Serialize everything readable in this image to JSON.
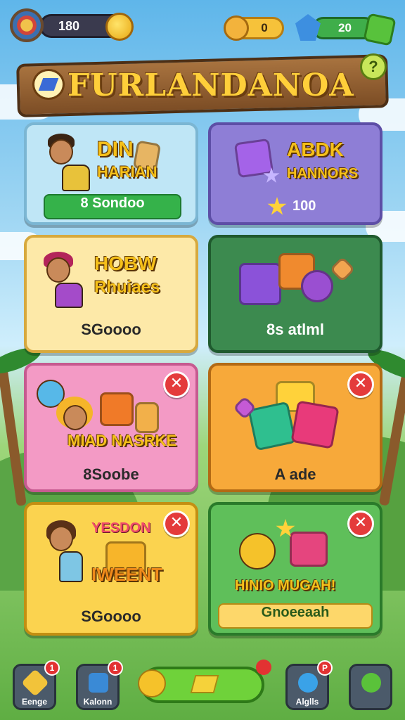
{
  "hud": {
    "coins": "180",
    "gold": "0",
    "gems": "20"
  },
  "banner": {
    "title": "FURLANDANOA"
  },
  "cards": [
    {
      "title_line1": "DIN",
      "title_line2": "HARIAN",
      "sub": "8 Sondoo",
      "color": "#bfe6f6"
    },
    {
      "title_line1": "ABDK",
      "title_line2": "HANNORS",
      "sub": "100",
      "color": "#8e7ed6"
    },
    {
      "title_line1": "HOBW",
      "title_line2": "Rhuiaes",
      "sub": "SGoooo",
      "color": "#fde9a8"
    },
    {
      "title_line1": "",
      "title_line2": "",
      "sub": "8s atlml",
      "color": "#3c8a4f"
    },
    {
      "title_line1": "MIAD NASRKE",
      "title_line2": "",
      "sub": "8Soobe",
      "color": "#f39ac5"
    },
    {
      "title_line1": "",
      "title_line2": "",
      "sub": "A ade",
      "color": "#f7a93a"
    },
    {
      "title_line1": "YESDON",
      "title_line2": "IWEENT",
      "sub": "SGoooo",
      "color": "#fbd34f"
    },
    {
      "title_line1": "HINIO MUGAH!",
      "title_line2": "",
      "sub": "Gnoeeaah",
      "color": "#5fbf5a"
    }
  ],
  "bottom_nav": [
    {
      "label": "Eenge",
      "badge": "1"
    },
    {
      "label": "Kalonn",
      "badge": "1"
    },
    {
      "label": "Alglls",
      "badge": "P"
    },
    {
      "label": ""
    }
  ],
  "icons": {
    "close": "✕",
    "help": "?",
    "star": "★"
  }
}
